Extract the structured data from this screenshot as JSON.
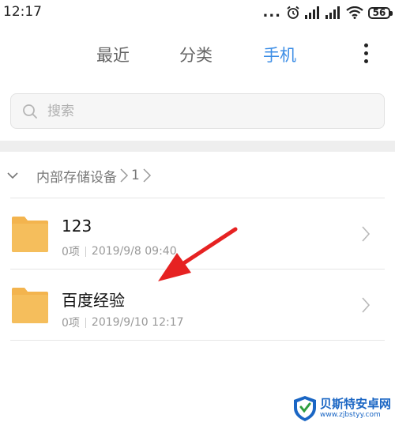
{
  "status_bar": {
    "time": "12:17",
    "dots": "...",
    "battery": "56",
    "icons": [
      "alarm-icon",
      "signal-icon",
      "signal-icon",
      "wifi-icon",
      "battery-icon"
    ]
  },
  "tabs": [
    {
      "label": "最近",
      "active": false
    },
    {
      "label": "分类",
      "active": false
    },
    {
      "label": "手机",
      "active": true
    }
  ],
  "accent_color": "#3d8ee6",
  "search": {
    "placeholder": "搜索",
    "value": ""
  },
  "breadcrumb": {
    "root": "内部存储设备",
    "current": "1"
  },
  "files": [
    {
      "name": "123",
      "count": "0项",
      "date": "2019/9/8 09:40"
    },
    {
      "name": "百度经验",
      "count": "0项",
      "date": "2019/9/10 12:17"
    }
  ],
  "folder_color": "#f3b44e",
  "annotation_color": "#e62222",
  "watermark": {
    "title": "贝斯特安卓网",
    "url": "www.zjbstyy.com"
  }
}
